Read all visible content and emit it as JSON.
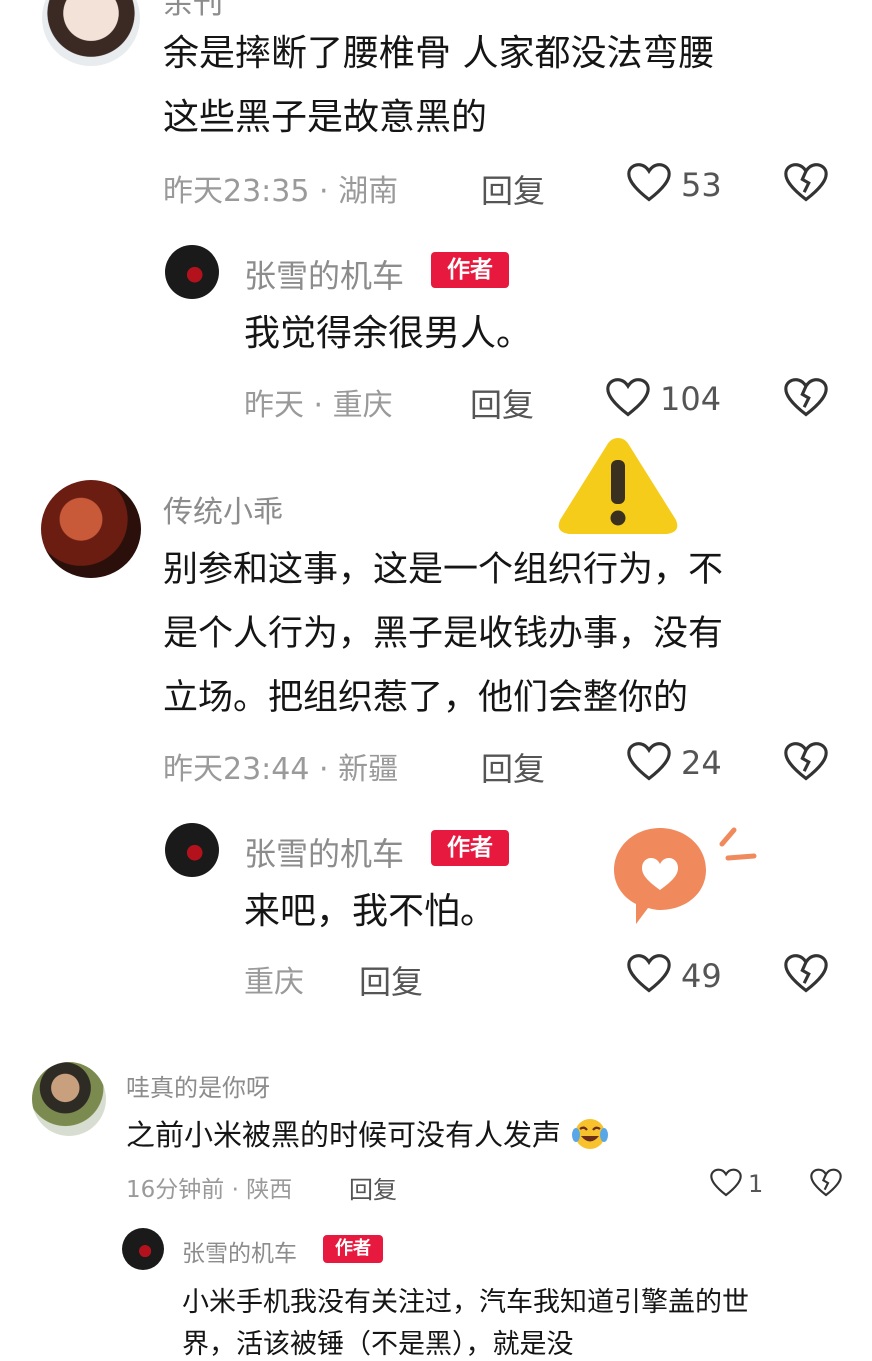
{
  "comments": [
    {
      "name": "余刊",
      "text_lines": [
        "余是摔断了腰椎骨  人家都没法弯腰",
        "这些黑子是故意黑的"
      ],
      "time": "昨天23:35 · 湖南",
      "reply": "回复",
      "likes": "53"
    },
    {
      "name": "张雪的机车",
      "badge": "作者",
      "text": "我觉得余很男人。",
      "time": "昨天 · 重庆",
      "reply": "回复",
      "likes": "104"
    },
    {
      "name": "传统小乖",
      "text_lines": [
        "别参和这事，这是一个组织行为，不",
        "是个人行为，黑子是收钱办事，没有",
        "立场。把组织惹了，他们会整你的"
      ],
      "time": "昨天23:44 · 新疆",
      "reply": "回复",
      "likes": "24"
    },
    {
      "name": "张雪的机车",
      "badge": "作者",
      "text": "来吧，我不怕。",
      "time": "重庆",
      "reply": "回复",
      "likes": "49"
    },
    {
      "name": "哇真的是你呀",
      "text": "之前小米被黑的时候可没有人发声",
      "time": "16分钟前 · 陕西",
      "reply": "回复",
      "likes": "1"
    },
    {
      "name": "张雪的机车",
      "badge": "作者",
      "text_lines": [
        "小米手机我没有关注过，汽车我知道引擎盖的世",
        "界，活该被锤（不是黑），就是没"
      ]
    }
  ],
  "colors": {
    "badge": "#e8193e",
    "warning": "#f6cc1a",
    "heart_bubble": "#f08a5d"
  }
}
